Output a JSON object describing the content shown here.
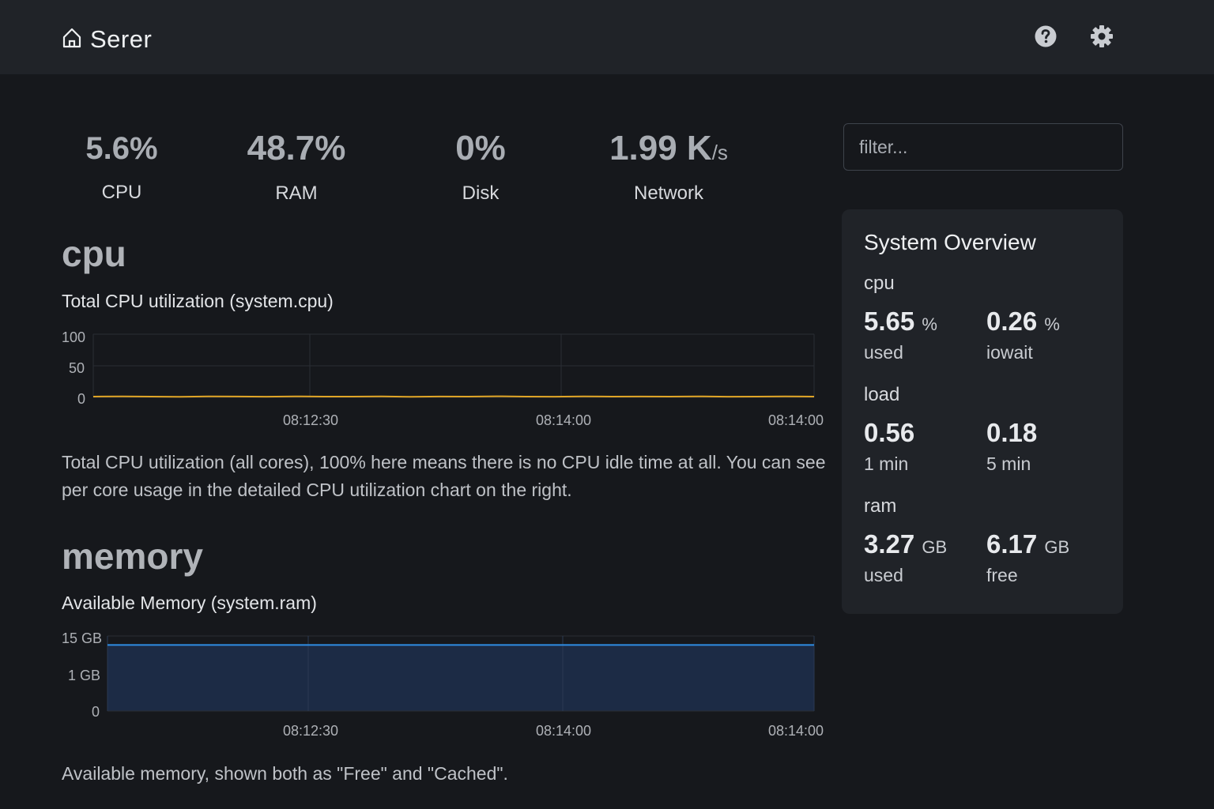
{
  "app": {
    "name": "Serer"
  },
  "kpis": [
    {
      "value": "5.6%",
      "unit": "",
      "label": "CPU"
    },
    {
      "value": "48.7%",
      "unit": "",
      "label": "RAM"
    },
    {
      "value": "0%",
      "unit": "",
      "label": "Disk"
    },
    {
      "value": "1.99 K",
      "unit": "/s",
      "label": "Network"
    }
  ],
  "sections": {
    "cpu": {
      "title": "cpu",
      "chart_title": "Total CPU utilization (system.cpu)",
      "description": "Total CPU utilization (all cores), 100% here means there is no CPU idle time at all. You can see per core usage in the detailed CPU utilization chart on the right."
    },
    "memory": {
      "title": "memory",
      "chart_title": "Available Memory (system.ram)",
      "description": "Available memory, shown both as \"Free\" and \"Cached\"."
    }
  },
  "filter": {
    "placeholder": "filter..."
  },
  "overview": {
    "title": "System Overview",
    "groups": [
      {
        "label": "cpu",
        "stats": [
          {
            "value": "5.65",
            "unit": "%",
            "label": "used"
          },
          {
            "value": "0.26",
            "unit": "%",
            "label": "iowait"
          }
        ]
      },
      {
        "label": "load",
        "stats": [
          {
            "value": "0.56",
            "unit": "",
            "label": "1 min"
          },
          {
            "value": "0.18",
            "unit": "",
            "label": "5 min"
          }
        ]
      },
      {
        "label": "ram",
        "stats": [
          {
            "value": "3.27",
            "unit": "GB",
            "label": "used"
          },
          {
            "value": "6.17",
            "unit": "GB",
            "label": "free"
          }
        ]
      }
    ]
  },
  "chart_data": [
    {
      "type": "line",
      "title": "Total CPU utilization (system.cpu)",
      "y_ticks": [
        "100",
        "50",
        "0"
      ],
      "x_ticks": [
        "08:12:30",
        "08:14:00",
        "08:14:00"
      ],
      "ylim": [
        0,
        100
      ],
      "grid": true,
      "color": "#e0a526",
      "series": [
        {
          "values": [
            1.2,
            1.6,
            1.3,
            1.0,
            1.5,
            1.4,
            1.1,
            1.6,
            1.3,
            1.2,
            1.5,
            1.0,
            1.4,
            1.3,
            1.7,
            1.2,
            1.1,
            1.5,
            1.3,
            1.4,
            1.2,
            1.6,
            1.1,
            1.3,
            1.5,
            1.2
          ]
        }
      ]
    },
    {
      "type": "area",
      "title": "Available Memory (system.ram)",
      "y_ticks": [
        "15 GB",
        "1 GB",
        "0"
      ],
      "x_ticks": [
        "08:12:30",
        "08:14:00",
        "08:14:00"
      ],
      "grid": true,
      "color": "#2f8de4",
      "fill": "#1c2b45",
      "series": [
        {
          "values": [
            0.88,
            0.88,
            0.88,
            0.88,
            0.88,
            0.88,
            0.88,
            0.88
          ]
        }
      ]
    }
  ],
  "colors": {
    "background": "#16181c",
    "topbar": "#202328",
    "panel": "#202328",
    "cpu_line": "#e0a526",
    "ram_line": "#2f8de4"
  }
}
